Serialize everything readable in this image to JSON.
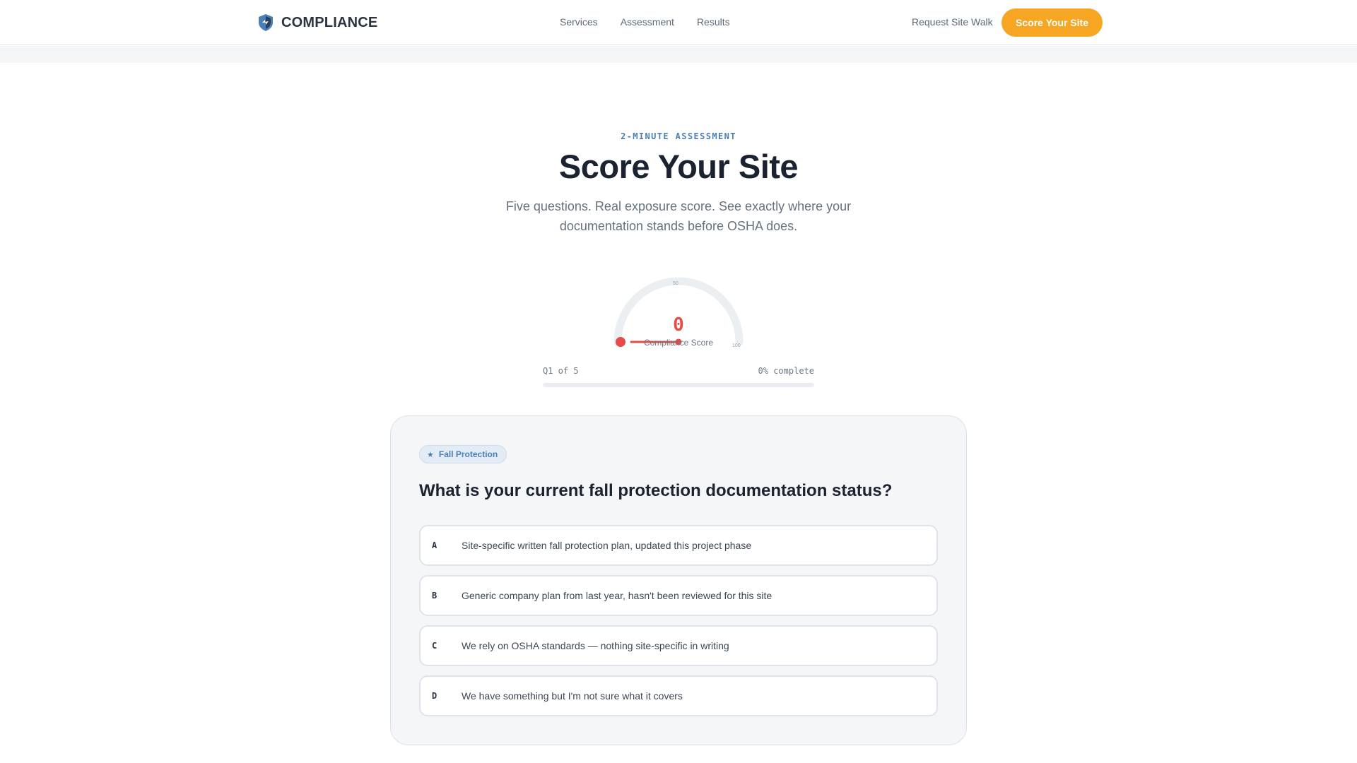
{
  "header": {
    "brand": "COMPLIANCE",
    "nav": [
      "Services",
      "Assessment",
      "Results"
    ],
    "request_link": "Request Site Walk",
    "cta_label": "Score Your Site"
  },
  "hero": {
    "eyebrow": "2-MINUTE ASSESSMENT",
    "title": "Score Your Site",
    "subtitle": "Five questions. Real exposure score. See exactly where your documentation stands before OSHA does."
  },
  "gauge": {
    "score": "0",
    "label": "Compliance Score",
    "tick_mid": "50",
    "tick_max": "100",
    "score_fraction": 0,
    "score_color": "#e84a4a"
  },
  "progress": {
    "question_label": "Q1 of 5",
    "complete_label": "0% complete",
    "fraction": 0
  },
  "question": {
    "category": "Fall Protection",
    "category_icon": "star-icon",
    "text": "What is your current fall protection documentation status?",
    "options": [
      {
        "letter": "A",
        "text": "Site-specific written fall protection plan, updated this project phase"
      },
      {
        "letter": "B",
        "text": "Generic company plan from last year, hasn't been reviewed for this site"
      },
      {
        "letter": "C",
        "text": "We rely on OSHA standards — nothing site-specific in writing"
      },
      {
        "letter": "D",
        "text": "We have something but I'm not sure what it covers"
      }
    ]
  },
  "colors": {
    "accent": "#f6a623",
    "brand_blue": "#4a7fb5",
    "danger": "#e84a4a"
  }
}
